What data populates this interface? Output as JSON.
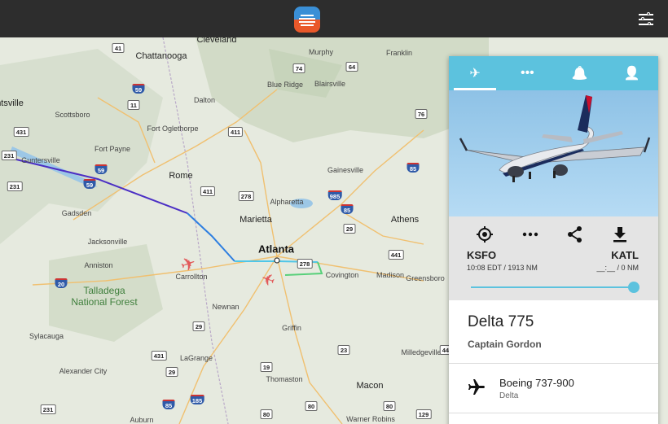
{
  "topbar": {
    "logo_icon": "app-logo-icon",
    "settings_icon": "sliders-icon"
  },
  "map": {
    "places": [
      {
        "name": "Cleveland",
        "cls": "big"
      },
      {
        "name": "Chattanooga",
        "cls": "big"
      },
      {
        "name": "Murphy",
        "cls": ""
      },
      {
        "name": "Franklin",
        "cls": ""
      },
      {
        "name": "Fort Oglethorpe",
        "cls": ""
      },
      {
        "name": "Dalton",
        "cls": ""
      },
      {
        "name": "Blue Ridge",
        "cls": ""
      },
      {
        "name": "Blairsville",
        "cls": ""
      },
      {
        "name": "Scottsboro",
        "cls": ""
      },
      {
        "name": "ntsville",
        "cls": "big"
      },
      {
        "name": "Fort Payne",
        "cls": ""
      },
      {
        "name": "Guntersville",
        "cls": ""
      },
      {
        "name": "Rome",
        "cls": "big"
      },
      {
        "name": "Gainesville",
        "cls": ""
      },
      {
        "name": "Alpharetta",
        "cls": ""
      },
      {
        "name": "Gadsden",
        "cls": ""
      },
      {
        "name": "Marietta",
        "cls": "big"
      },
      {
        "name": "Athens",
        "cls": "big"
      },
      {
        "name": "Atlanta",
        "cls": "major"
      },
      {
        "name": "Jacksonville",
        "cls": ""
      },
      {
        "name": "Anniston",
        "cls": ""
      },
      {
        "name": "Carrollton",
        "cls": ""
      },
      {
        "name": "Covington",
        "cls": ""
      },
      {
        "name": "Madison",
        "cls": ""
      },
      {
        "name": "Greensboro",
        "cls": ""
      },
      {
        "name": "Newnan",
        "cls": ""
      },
      {
        "name": "Griffin",
        "cls": ""
      },
      {
        "name": "Sylacauga",
        "cls": ""
      },
      {
        "name": "LaGrange",
        "cls": ""
      },
      {
        "name": "Milledgeville",
        "cls": ""
      },
      {
        "name": "Alexander City",
        "cls": ""
      },
      {
        "name": "Thomaston",
        "cls": ""
      },
      {
        "name": "Macon",
        "cls": "big"
      },
      {
        "name": "Auburn",
        "cls": ""
      },
      {
        "name": "Warner Robins",
        "cls": ""
      }
    ],
    "park": "Talladega\nNational Forest",
    "shields": [
      {
        "num": "41",
        "type": "us"
      },
      {
        "num": "74",
        "type": "us"
      },
      {
        "num": "64",
        "type": "us"
      },
      {
        "num": "59",
        "type": "interstate"
      },
      {
        "num": "11",
        "type": "us"
      },
      {
        "num": "76",
        "type": "us"
      },
      {
        "num": "431",
        "type": "us"
      },
      {
        "num": "411",
        "type": "us"
      },
      {
        "num": "231",
        "type": "us"
      },
      {
        "num": "59",
        "type": "interstate"
      },
      {
        "num": "85",
        "type": "interstate"
      },
      {
        "num": "231",
        "type": "us"
      },
      {
        "num": "59",
        "type": "interstate"
      },
      {
        "num": "411",
        "type": "us"
      },
      {
        "num": "985",
        "type": "interstate"
      },
      {
        "num": "278",
        "type": "us"
      },
      {
        "num": "85",
        "type": "interstate"
      },
      {
        "num": "29",
        "type": "us"
      },
      {
        "num": "441",
        "type": "us"
      },
      {
        "num": "278",
        "type": "us"
      },
      {
        "num": "20",
        "type": "interstate"
      },
      {
        "num": "29",
        "type": "us"
      },
      {
        "num": "23",
        "type": "us"
      },
      {
        "num": "431",
        "type": "us"
      },
      {
        "num": "441",
        "type": "us"
      },
      {
        "num": "29",
        "type": "us"
      },
      {
        "num": "19",
        "type": "us"
      },
      {
        "num": "185",
        "type": "interstate"
      },
      {
        "num": "85",
        "type": "interstate"
      },
      {
        "num": "80",
        "type": "us"
      },
      {
        "num": "80",
        "type": "us"
      },
      {
        "num": "231",
        "type": "us"
      },
      {
        "num": "80",
        "type": "us"
      },
      {
        "num": "129",
        "type": "us"
      }
    ]
  },
  "panel": {
    "tabs": [
      {
        "icon": "airplane-icon",
        "glyph": "✈"
      },
      {
        "icon": "route-dots-icon",
        "glyph": "•••"
      },
      {
        "icon": "alerts-bell-icon",
        "glyph": "🔔"
      },
      {
        "icon": "account-person-icon",
        "glyph": "👤"
      }
    ],
    "actions": [
      {
        "icon": "locate-target-icon"
      },
      {
        "icon": "more-dots-icon"
      },
      {
        "icon": "share-icon"
      },
      {
        "icon": "download-icon"
      }
    ],
    "origin": "KSFO",
    "origin_sub": "10:08 EDT / 1913 NM",
    "destination": "KATL",
    "destination_sub": "__:__ / 0 NM",
    "progress": 1.0,
    "flight_title": "Delta 775",
    "captain": "Captain Gordon",
    "aircraft_model": "Boeing 737-900",
    "airline": "Delta",
    "accent": "#5cc2de"
  }
}
